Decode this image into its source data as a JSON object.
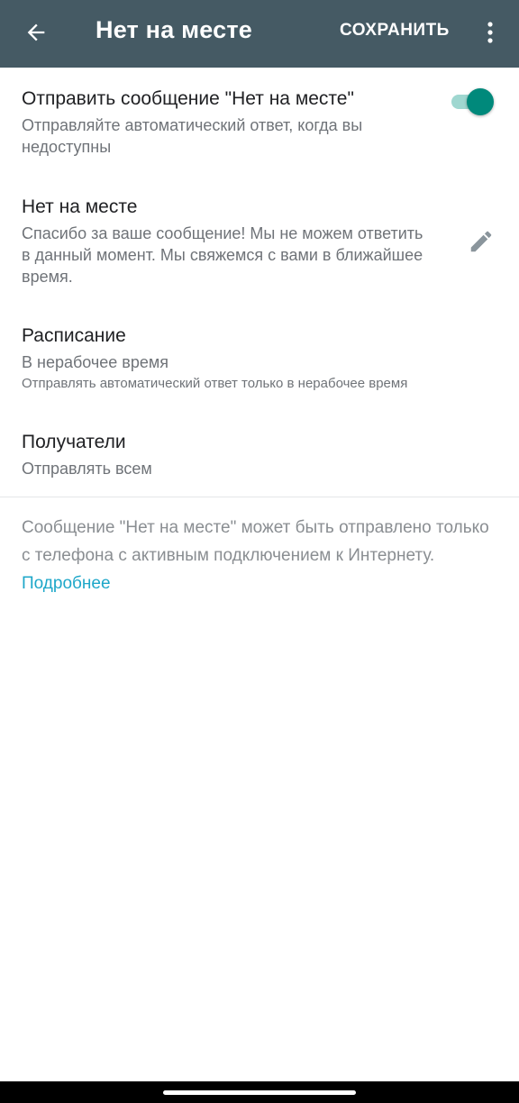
{
  "app_bar": {
    "title": "Нет на месте",
    "save_label": "СОХРАНИТЬ",
    "background": "#455a64"
  },
  "away_toggle": {
    "title": "Отправить сообщение \"Нет на месте\"",
    "subtitle": "Отправляйте автоматический ответ, когда вы недоступны",
    "enabled": true,
    "accent": "#00897b"
  },
  "message": {
    "title": "Нет на месте",
    "text": "Спасибо за ваше сообщение! Мы не можем ответить в данный момент. Мы свяжемся с вами в ближайшее время."
  },
  "schedule": {
    "title": "Расписание",
    "value": "В нерабочее время",
    "note": "Отправлять автоматический ответ только в нерабочее время"
  },
  "recipients": {
    "title": "Получатели",
    "value": "Отправлять всем"
  },
  "footer": {
    "note": "Сообщение \"Нет на месте\" может быть отправлено только с телефона с активным подключением к Интернету.",
    "link": "Подробнее",
    "link_color": "#1ea7c9"
  },
  "icons": {
    "back": "arrow-left-icon",
    "more": "more-vert-icon",
    "edit": "pencil-icon"
  }
}
